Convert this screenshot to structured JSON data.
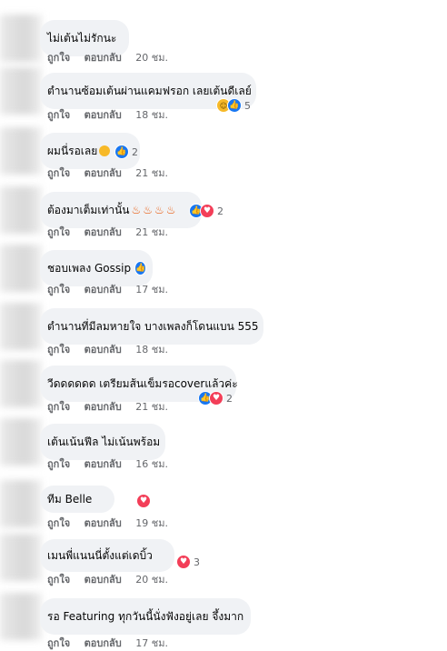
{
  "actions": {
    "like": "ถูกใจ",
    "reply": "ตอบกลับ"
  },
  "comments": [
    {
      "text": "ไม่เต้นไม่รักนะ",
      "time": "20 ชม."
    },
    {
      "text": "ตำนานซ้อมเต้นผ่านแคมฟรอก เลยเต้นดีเลย์",
      "time": "18 ชม.",
      "reaction_count": "5",
      "reactions": [
        "haha-icon",
        "like-icon"
      ]
    },
    {
      "text": "ผมนี่รอเลย",
      "time": "21 ชม.",
      "reaction_count": "2",
      "reactions": [
        "like-icon"
      ]
    },
    {
      "text": "ต้องมาเต็มเท่านั้น",
      "time": "21 ชม.",
      "reaction_count": "2",
      "reactions": [
        "like-icon",
        "love-icon"
      ]
    },
    {
      "text": "ชอบเพลง Gossip",
      "time": "17 ชม.",
      "reactions": [
        "like-icon"
      ]
    },
    {
      "text": "ตำนานที่มีลมหายใจ บางเพลงก็โดนแบน 555",
      "time": "18 ชม."
    },
    {
      "text": "วีดดดดดด เตรียมส้นเข็มรอcoverแล้วค่ะ",
      "time": "21 ชม.",
      "reaction_count": "2",
      "reactions": [
        "like-icon",
        "love-icon"
      ]
    },
    {
      "text": "เต้นเน้นฟีล ไม่เน้นพร้อม",
      "time": "16 ชม."
    },
    {
      "text": "ทีม Belle",
      "time": "19 ชม.",
      "reactions": [
        "love-icon"
      ]
    },
    {
      "text": "เมนพี่แนนนี่ตั้งแต่เดบิ้ว",
      "time": "20 ชม.",
      "reaction_count": "3",
      "reactions": [
        "love-icon"
      ]
    },
    {
      "text": "รอ Featuring ทุกวันนี้นั่งฟังอยู่เลย จึ้งมาก",
      "time": "17 ชม."
    }
  ]
}
